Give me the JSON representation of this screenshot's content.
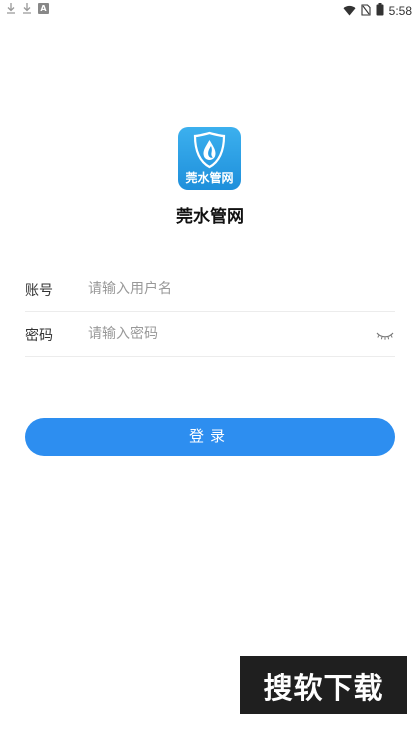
{
  "status_bar": {
    "time": "5:58",
    "left_icons": [
      "download-icon",
      "download-icon",
      "a-badge-icon"
    ],
    "right_icons": [
      "wifi-icon",
      "no-sim-icon",
      "battery-icon"
    ],
    "a_badge": "A"
  },
  "app": {
    "logo_text": "莞水管网",
    "title": "莞水管网"
  },
  "form": {
    "username_label": "账号",
    "username_placeholder": "请输入用户名",
    "username_value": "",
    "password_label": "密码",
    "password_placeholder": "请输入密码",
    "password_value": "",
    "password_toggle_icon": "eye-closed-icon"
  },
  "login_button": {
    "label": "登录"
  },
  "watermark": {
    "text": "搜软下载"
  },
  "colors": {
    "primary": "#2d8ef0",
    "logo_top": "#3cb0ee",
    "logo_bottom": "#1e8fdb",
    "divider": "#ececec",
    "placeholder": "#999999",
    "watermark_bg": "#1f1f1f"
  }
}
